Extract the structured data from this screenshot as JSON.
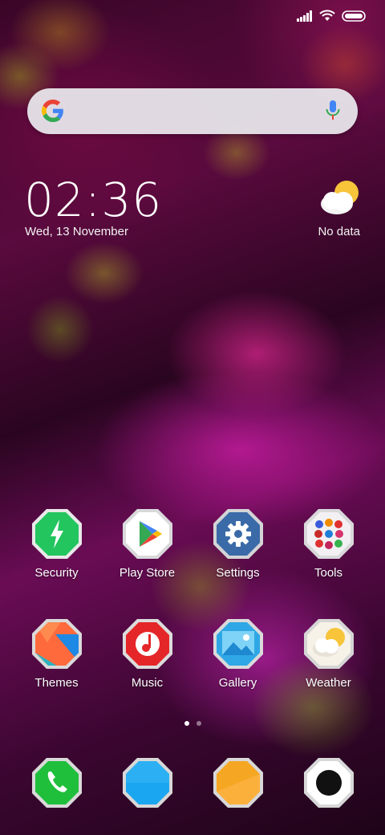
{
  "status_bar": {
    "icons": [
      "signal-icon",
      "wifi-icon",
      "battery-icon"
    ]
  },
  "search": {
    "provider_icon": "google-g-icon",
    "voice_icon": "microphone-icon"
  },
  "clock": {
    "time": "02:36",
    "date": "Wed, 13 November"
  },
  "weather_widget": {
    "icon": "partly-cloudy-icon",
    "status": "No data"
  },
  "apps_row1": [
    {
      "label": "Security",
      "icon": "security-bolt-icon"
    },
    {
      "label": "Play Store",
      "icon": "play-store-icon"
    },
    {
      "label": "Settings",
      "icon": "gear-icon"
    },
    {
      "label": "Tools",
      "icon": "tools-folder-icon"
    }
  ],
  "apps_row2": [
    {
      "label": "Themes",
      "icon": "themes-icon"
    },
    {
      "label": "Music",
      "icon": "music-icon"
    },
    {
      "label": "Gallery",
      "icon": "gallery-icon"
    },
    {
      "label": "Weather",
      "icon": "weather-app-icon"
    }
  ],
  "page_indicator": {
    "pages": 2,
    "active": 1
  },
  "dock": [
    {
      "icon": "phone-icon"
    },
    {
      "icon": "messages-icon"
    },
    {
      "icon": "browser-icon"
    },
    {
      "icon": "camera-icon"
    }
  ],
  "colors": {
    "security": "#22c55e",
    "settings": "#3b6aa8",
    "music": "#e52629",
    "gallery": "#2fa7e6",
    "phone": "#1fbf3c",
    "messages": "#1aa6f0",
    "browser": "#f5a623"
  }
}
